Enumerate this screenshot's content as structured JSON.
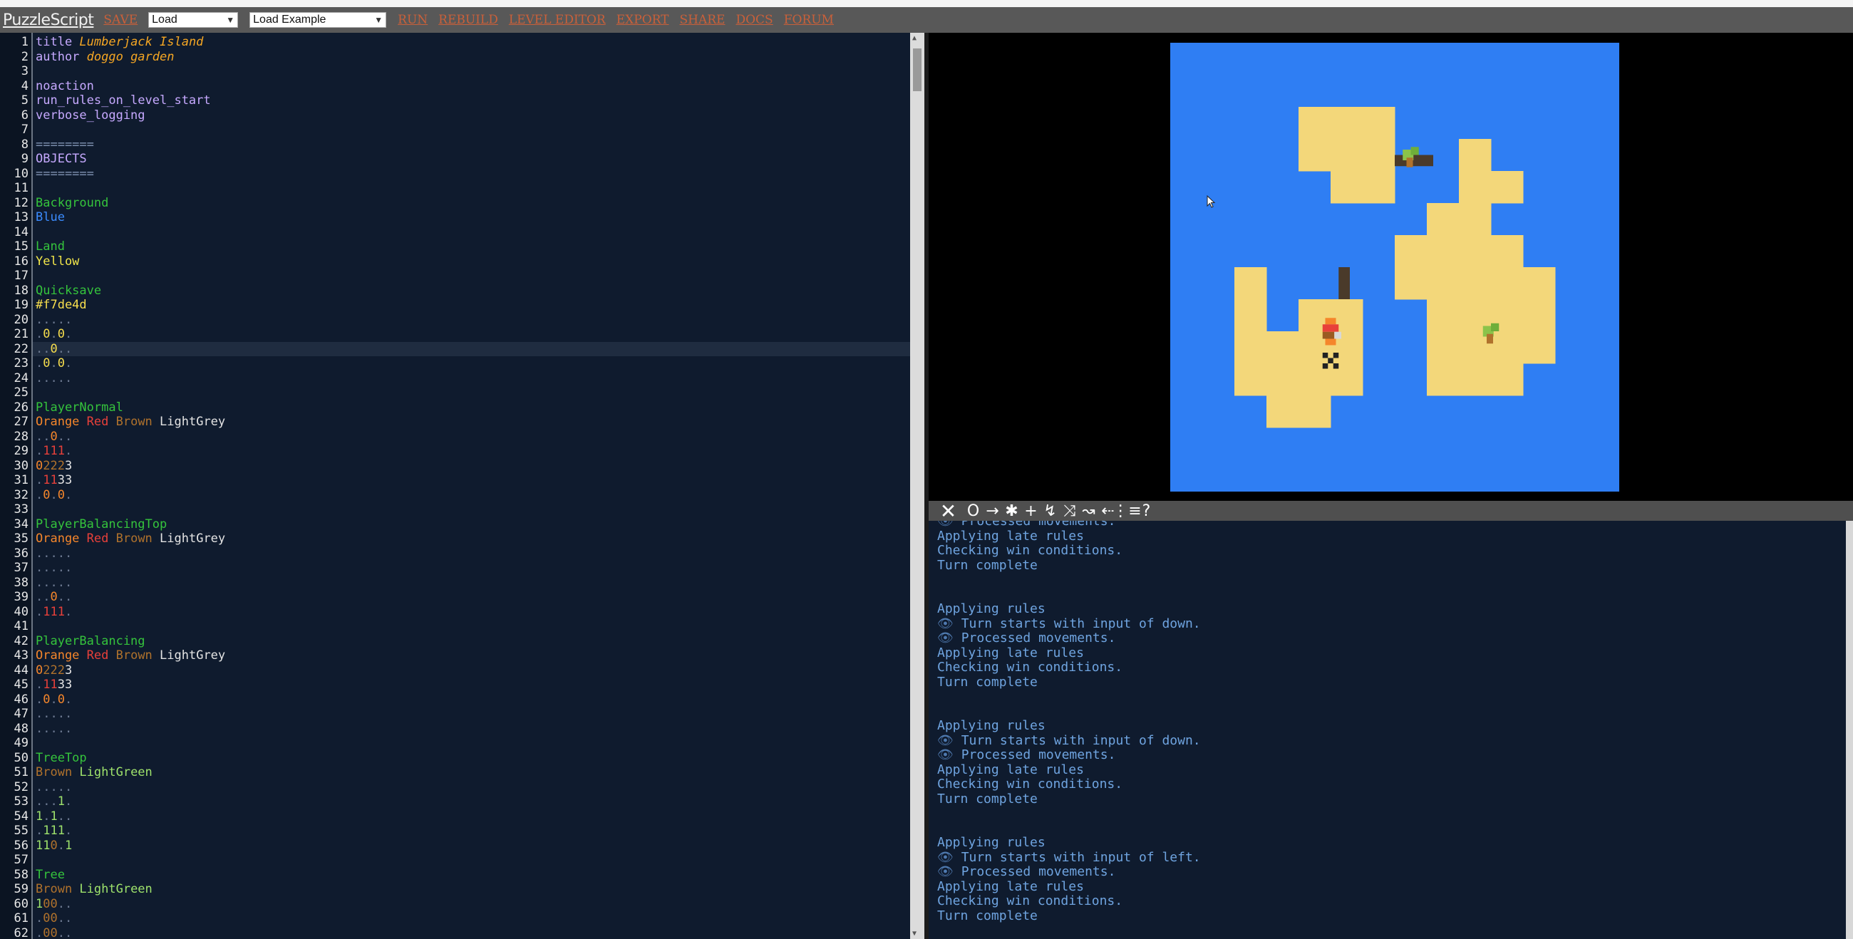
{
  "toolbar": {
    "logo": "PuzzleScript",
    "save": "SAVE",
    "load_select": "Load",
    "example_select": "Load Example",
    "run": "RUN",
    "rebuild": "REBUILD",
    "level_editor": "LEVEL EDITOR",
    "export": "EXPORT",
    "share": "SHARE",
    "docs": "DOCS",
    "forum": "FORUM"
  },
  "colors": {
    "ocean": "#2f7ef3",
    "land": "#f3d77a",
    "editor_bg": "#0f1b2e",
    "keyword": "#c6a9ff",
    "object_name": "#35c43c",
    "comment": "#8093b3"
  },
  "editor": {
    "current_line": 22,
    "line_numbers": [
      "1",
      "2",
      "3",
      "4",
      "5",
      "6",
      "7",
      "8",
      "9",
      "10",
      "11",
      "12",
      "13",
      "14",
      "15",
      "16",
      "17",
      "18",
      "19",
      "20",
      "21",
      "22",
      "23",
      "24",
      "25",
      "26",
      "27",
      "28",
      "29",
      "30",
      "31",
      "32",
      "33",
      "34",
      "35",
      "36",
      "37",
      "38",
      "39",
      "40",
      "41",
      "42",
      "43",
      "44",
      "45",
      "46",
      "47",
      "48",
      "49",
      "50",
      "51",
      "52",
      "53",
      "54",
      "55",
      "56",
      "57",
      "58",
      "59",
      "60",
      "61",
      "62"
    ],
    "lines": [
      [
        {
          "t": "title ",
          "c": "#c6a9ff"
        },
        {
          "t": "Lumberjack Island",
          "c": "#f5a623",
          "i": true
        }
      ],
      [
        {
          "t": "author ",
          "c": "#c6a9ff"
        },
        {
          "t": "doggo garden",
          "c": "#f5a623",
          "i": true
        }
      ],
      [],
      [
        {
          "t": "noaction",
          "c": "#c6a9ff"
        }
      ],
      [
        {
          "t": "run_rules_on_level_start",
          "c": "#c6a9ff"
        }
      ],
      [
        {
          "t": "verbose_logging",
          "c": "#c6a9ff"
        }
      ],
      [],
      [
        {
          "t": "========",
          "c": "#8093b3"
        }
      ],
      [
        {
          "t": "OBJECTS",
          "c": "#c6a9ff"
        }
      ],
      [
        {
          "t": "========",
          "c": "#8093b3"
        }
      ],
      [],
      [
        {
          "t": "Background",
          "c": "#35c43c"
        }
      ],
      [
        {
          "t": "Blue",
          "c": "#3b8cff"
        }
      ],
      [],
      [
        {
          "t": "Land",
          "c": "#35c43c"
        }
      ],
      [
        {
          "t": "Yellow",
          "c": "#f2e64a"
        }
      ],
      [],
      [
        {
          "t": "Quicksave",
          "c": "#35c43c"
        }
      ],
      [
        {
          "t": "#f7de4d",
          "c": "#f7de4d"
        }
      ],
      [
        {
          "t": ".....",
          "c": "#6d7a92"
        }
      ],
      [
        {
          "t": ".",
          "c": "#6d7a92"
        },
        {
          "t": "0",
          "c": "#f7de4d"
        },
        {
          "t": ".",
          "c": "#6d7a92"
        },
        {
          "t": "0",
          "c": "#f7de4d"
        },
        {
          "t": ".",
          "c": "#6d7a92"
        }
      ],
      [
        {
          "t": "..",
          "c": "#6d7a92"
        },
        {
          "t": "0",
          "c": "#f7de4d"
        },
        {
          "t": "..",
          "c": "#6d7a92"
        }
      ],
      [
        {
          "t": ".",
          "c": "#6d7a92"
        },
        {
          "t": "0",
          "c": "#f7de4d"
        },
        {
          "t": ".",
          "c": "#6d7a92"
        },
        {
          "t": "0",
          "c": "#f7de4d"
        },
        {
          "t": ".",
          "c": "#6d7a92"
        }
      ],
      [
        {
          "t": ".....",
          "c": "#6d7a92"
        }
      ],
      [],
      [
        {
          "t": "PlayerNormal",
          "c": "#35c43c"
        }
      ],
      [
        {
          "t": "Orange ",
          "c": "#f5862b"
        },
        {
          "t": "Red ",
          "c": "#e8403a"
        },
        {
          "t": "Brown ",
          "c": "#b0722c"
        },
        {
          "t": "LightGrey",
          "c": "#e4e4e4"
        }
      ],
      [
        {
          "t": "..",
          "c": "#6d7a92"
        },
        {
          "t": "0",
          "c": "#f5862b"
        },
        {
          "t": "..",
          "c": "#6d7a92"
        }
      ],
      [
        {
          "t": ".",
          "c": "#6d7a92"
        },
        {
          "t": "111",
          "c": "#e8403a"
        },
        {
          "t": ".",
          "c": "#6d7a92"
        }
      ],
      [
        {
          "t": "0",
          "c": "#f5862b"
        },
        {
          "t": "222",
          "c": "#b0722c"
        },
        {
          "t": "3",
          "c": "#e4e4e4"
        }
      ],
      [
        {
          "t": ".",
          "c": "#6d7a92"
        },
        {
          "t": "11",
          "c": "#e8403a"
        },
        {
          "t": "33",
          "c": "#e4e4e4"
        }
      ],
      [
        {
          "t": ".",
          "c": "#6d7a92"
        },
        {
          "t": "0",
          "c": "#f5862b"
        },
        {
          "t": ".",
          "c": "#6d7a92"
        },
        {
          "t": "0",
          "c": "#f5862b"
        },
        {
          "t": ".",
          "c": "#6d7a92"
        }
      ],
      [],
      [
        {
          "t": "PlayerBalancingTop",
          "c": "#35c43c"
        }
      ],
      [
        {
          "t": "Orange ",
          "c": "#f5862b"
        },
        {
          "t": "Red ",
          "c": "#e8403a"
        },
        {
          "t": "Brown ",
          "c": "#b0722c"
        },
        {
          "t": "LightGrey",
          "c": "#e4e4e4"
        }
      ],
      [
        {
          "t": ".....",
          "c": "#6d7a92"
        }
      ],
      [
        {
          "t": ".....",
          "c": "#6d7a92"
        }
      ],
      [
        {
          "t": ".....",
          "c": "#6d7a92"
        }
      ],
      [
        {
          "t": "..",
          "c": "#6d7a92"
        },
        {
          "t": "0",
          "c": "#f5862b"
        },
        {
          "t": "..",
          "c": "#6d7a92"
        }
      ],
      [
        {
          "t": ".",
          "c": "#6d7a92"
        },
        {
          "t": "111",
          "c": "#e8403a"
        },
        {
          "t": ".",
          "c": "#6d7a92"
        }
      ],
      [],
      [
        {
          "t": "PlayerBalancing",
          "c": "#35c43c"
        }
      ],
      [
        {
          "t": "Orange ",
          "c": "#f5862b"
        },
        {
          "t": "Red ",
          "c": "#e8403a"
        },
        {
          "t": "Brown ",
          "c": "#b0722c"
        },
        {
          "t": "LightGrey",
          "c": "#e4e4e4"
        }
      ],
      [
        {
          "t": "0",
          "c": "#f5862b"
        },
        {
          "t": "222",
          "c": "#b0722c"
        },
        {
          "t": "3",
          "c": "#e4e4e4"
        }
      ],
      [
        {
          "t": ".",
          "c": "#6d7a92"
        },
        {
          "t": "11",
          "c": "#e8403a"
        },
        {
          "t": "33",
          "c": "#e4e4e4"
        }
      ],
      [
        {
          "t": ".",
          "c": "#6d7a92"
        },
        {
          "t": "0",
          "c": "#f5862b"
        },
        {
          "t": ".",
          "c": "#6d7a92"
        },
        {
          "t": "0",
          "c": "#f5862b"
        },
        {
          "t": ".",
          "c": "#6d7a92"
        }
      ],
      [
        {
          "t": ".....",
          "c": "#6d7a92"
        }
      ],
      [
        {
          "t": ".....",
          "c": "#6d7a92"
        }
      ],
      [],
      [
        {
          "t": "TreeTop",
          "c": "#35c43c"
        }
      ],
      [
        {
          "t": "Brown ",
          "c": "#b0722c"
        },
        {
          "t": "LightGreen",
          "c": "#9fe36c"
        }
      ],
      [
        {
          "t": ".....",
          "c": "#6d7a92"
        }
      ],
      [
        {
          "t": "...",
          "c": "#6d7a92"
        },
        {
          "t": "1",
          "c": "#9fe36c"
        },
        {
          "t": ".",
          "c": "#6d7a92"
        }
      ],
      [
        {
          "t": "1",
          "c": "#9fe36c"
        },
        {
          "t": ".",
          "c": "#6d7a92"
        },
        {
          "t": "1",
          "c": "#9fe36c"
        },
        {
          "t": "..",
          "c": "#6d7a92"
        }
      ],
      [
        {
          "t": ".",
          "c": "#6d7a92"
        },
        {
          "t": "111",
          "c": "#9fe36c"
        },
        {
          "t": ".",
          "c": "#6d7a92"
        }
      ],
      [
        {
          "t": "11",
          "c": "#9fe36c"
        },
        {
          "t": "0",
          "c": "#b0722c"
        },
        {
          "t": ".",
          "c": "#6d7a92"
        },
        {
          "t": "1",
          "c": "#9fe36c"
        }
      ],
      [],
      [
        {
          "t": "Tree",
          "c": "#35c43c"
        }
      ],
      [
        {
          "t": "Brown ",
          "c": "#b0722c"
        },
        {
          "t": "LightGreen",
          "c": "#9fe36c"
        }
      ],
      [
        {
          "t": "1",
          "c": "#9fe36c"
        },
        {
          "t": "00",
          "c": "#b0722c"
        },
        {
          "t": "..",
          "c": "#6d7a92"
        }
      ],
      [
        {
          "t": ".",
          "c": "#6d7a92"
        },
        {
          "t": "00",
          "c": "#b0722c"
        },
        {
          "t": "..",
          "c": "#6d7a92"
        }
      ],
      [
        {
          "t": ".",
          "c": "#6d7a92"
        },
        {
          "t": "00",
          "c": "#b0722c"
        },
        {
          "t": "..",
          "c": "#6d7a92"
        }
      ]
    ]
  },
  "game": {
    "grid_cols": 14,
    "grid_rows": 14,
    "land_cells": [
      [
        4,
        2
      ],
      [
        5,
        2
      ],
      [
        6,
        2
      ],
      [
        4,
        3
      ],
      [
        5,
        3
      ],
      [
        6,
        3
      ],
      [
        5,
        4
      ],
      [
        6,
        4
      ],
      [
        9,
        3
      ],
      [
        9,
        4
      ],
      [
        10,
        4
      ],
      [
        8,
        5
      ],
      [
        9,
        5
      ],
      [
        7,
        6
      ],
      [
        8,
        6
      ],
      [
        9,
        6
      ],
      [
        10,
        6
      ],
      [
        7,
        7
      ],
      [
        8,
        7
      ],
      [
        9,
        7
      ],
      [
        10,
        7
      ],
      [
        11,
        7
      ],
      [
        2,
        7
      ],
      [
        2,
        8
      ],
      [
        4,
        8
      ],
      [
        5,
        8
      ],
      [
        8,
        8
      ],
      [
        9,
        8
      ],
      [
        10,
        8
      ],
      [
        11,
        8
      ],
      [
        2,
        9
      ],
      [
        3,
        9
      ],
      [
        4,
        9
      ],
      [
        5,
        9
      ],
      [
        8,
        9
      ],
      [
        9,
        9
      ],
      [
        10,
        9
      ],
      [
        11,
        9
      ],
      [
        2,
        10
      ],
      [
        3,
        10
      ],
      [
        4,
        10
      ],
      [
        5,
        10
      ],
      [
        8,
        10
      ],
      [
        9,
        10
      ],
      [
        10,
        10
      ],
      [
        3,
        11
      ],
      [
        4,
        11
      ]
    ],
    "logs": [
      {
        "x": 7,
        "y": 3.5,
        "w": 1.2,
        "h": 0.35,
        "dir": "h"
      },
      {
        "x": 5.25,
        "y": 7,
        "w": 0.35,
        "h": 1,
        "dir": "v"
      }
    ],
    "trees": [
      [
        7,
        3
      ],
      [
        9.5,
        8.5
      ]
    ],
    "player": [
      4.5,
      8.5
    ],
    "quicksave": [
      4.5,
      9.5
    ]
  },
  "console_toolbar": {
    "buttons": [
      "✕",
      "O",
      "→",
      "✱",
      "+",
      "↯",
      "⤨",
      "↝",
      "⇠",
      "⋮≡",
      "?"
    ]
  },
  "console": {
    "lines": [
      {
        "t": "Processed movements.",
        "eye": true
      },
      {
        "t": "Applying late rules",
        "eye": false
      },
      {
        "t": "Checking win conditions.",
        "eye": false
      },
      {
        "t": "Turn complete",
        "eye": false
      },
      {
        "t": "",
        "eye": false
      },
      {
        "t": "",
        "eye": false
      },
      {
        "t": "Applying rules",
        "eye": false
      },
      {
        "t": "Turn starts with input of down.",
        "eye": true
      },
      {
        "t": "Processed movements.",
        "eye": true
      },
      {
        "t": "Applying late rules",
        "eye": false
      },
      {
        "t": "Checking win conditions.",
        "eye": false
      },
      {
        "t": "Turn complete",
        "eye": false
      },
      {
        "t": "",
        "eye": false
      },
      {
        "t": "",
        "eye": false
      },
      {
        "t": "Applying rules",
        "eye": false
      },
      {
        "t": "Turn starts with input of down.",
        "eye": true
      },
      {
        "t": "Processed movements.",
        "eye": true
      },
      {
        "t": "Applying late rules",
        "eye": false
      },
      {
        "t": "Checking win conditions.",
        "eye": false
      },
      {
        "t": "Turn complete",
        "eye": false
      },
      {
        "t": "",
        "eye": false
      },
      {
        "t": "",
        "eye": false
      },
      {
        "t": "Applying rules",
        "eye": false
      },
      {
        "t": "Turn starts with input of left.",
        "eye": true
      },
      {
        "t": "Processed movements.",
        "eye": true
      },
      {
        "t": "Applying late rules",
        "eye": false
      },
      {
        "t": "Checking win conditions.",
        "eye": false
      },
      {
        "t": "Turn complete",
        "eye": false
      }
    ]
  }
}
